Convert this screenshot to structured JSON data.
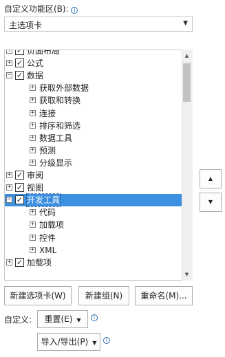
{
  "header": {
    "label": "自定义功能区(B):",
    "tabs_select_value": "主选项卡"
  },
  "tree": {
    "items": [
      {
        "label": "页面布局",
        "checked": true,
        "expander": "+",
        "level": 0
      },
      {
        "label": "公式",
        "checked": true,
        "expander": "+",
        "level": 0
      },
      {
        "label": "数据",
        "checked": true,
        "expander": "−",
        "level": 0
      },
      {
        "label": "获取外部数据",
        "expander": "+",
        "level": 1
      },
      {
        "label": "获取和转换",
        "expander": "+",
        "level": 1
      },
      {
        "label": "连接",
        "expander": "+",
        "level": 1
      },
      {
        "label": "排序和筛选",
        "expander": "+",
        "level": 1
      },
      {
        "label": "数据工具",
        "expander": "+",
        "level": 1
      },
      {
        "label": "预测",
        "expander": "+",
        "level": 1
      },
      {
        "label": "分级显示",
        "expander": "+",
        "level": 1
      },
      {
        "label": "审阅",
        "checked": true,
        "expander": "+",
        "level": 0
      },
      {
        "label": "视图",
        "checked": true,
        "expander": "+",
        "level": 0
      },
      {
        "label": "开发工具",
        "checked": true,
        "expander": "−",
        "level": 0,
        "selected": true
      },
      {
        "label": "代码",
        "expander": "+",
        "level": 1
      },
      {
        "label": "加载项",
        "expander": "+",
        "level": 1
      },
      {
        "label": "控件",
        "expander": "+",
        "level": 1
      },
      {
        "label": "XML",
        "expander": "+",
        "level": 1
      },
      {
        "label": "加载项",
        "checked": true,
        "expander": "+",
        "level": 0
      }
    ]
  },
  "buttons": {
    "new_tab": "新建选项卡(W)",
    "new_group": "新建组(N)",
    "rename": "重命名(M)...",
    "move_up_glyph": "▲",
    "move_down_glyph": "▼"
  },
  "customize": {
    "label": "自定义:",
    "reset": "重置(E)",
    "import_export": "导入/导出(P)"
  },
  "glyphs": {
    "info": "i",
    "dropdown": "▼",
    "check": "✓",
    "scroll_up": "▲",
    "scroll_down": "▼"
  },
  "colors": {
    "selection": "#3d8fe0",
    "info_icon": "#2b6cb0"
  }
}
